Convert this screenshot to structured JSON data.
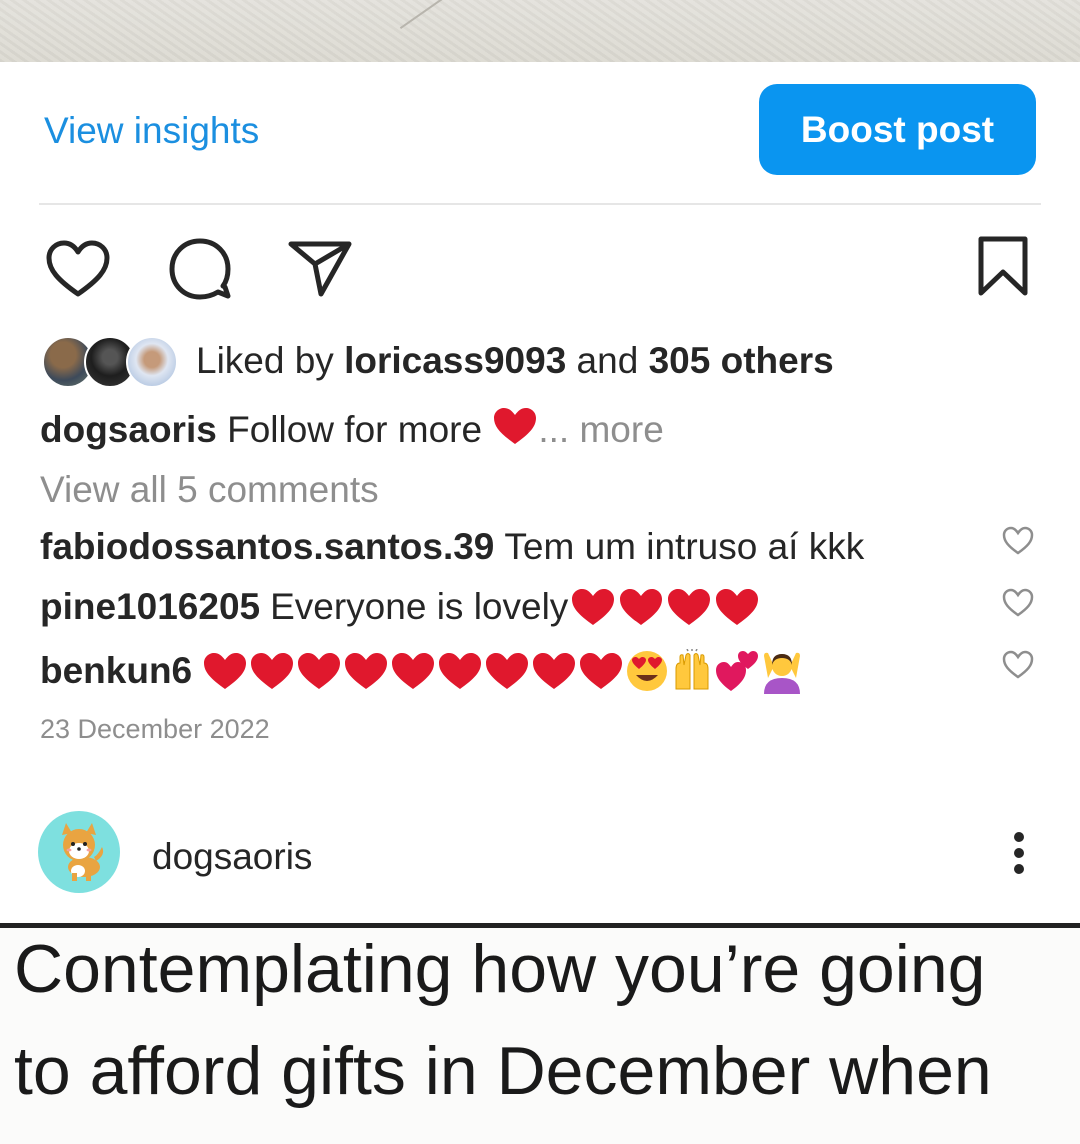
{
  "post1": {
    "actions": {
      "view_insights": "View insights",
      "boost_post": "Boost post"
    },
    "likes": {
      "prefix": "Liked by ",
      "user": "loricass9093",
      "middle": " and ",
      "others": "305 others"
    },
    "caption": {
      "username": "dogsaoris",
      "text": "Follow for more",
      "ellipsis": "...",
      "more": "more"
    },
    "view_comments": "View all 5 comments",
    "comments": [
      {
        "username": "fabiodossantos.santos.39",
        "text": "Tem um intruso  aí kkk"
      },
      {
        "username": "pine1016205",
        "text": "Everyone is lovely"
      },
      {
        "username": "benkun6",
        "text": ""
      }
    ],
    "date": "23 December 2022"
  },
  "post2": {
    "username": "dogsaoris",
    "image_text": [
      "Contemplating how you’re going",
      "to afford gifts in December when"
    ]
  },
  "colors": {
    "accent": "#0a95f0",
    "link": "#1b8fe0",
    "heart": "#e0182d",
    "muted": "#8e8e8e"
  },
  "icons": [
    "heart-icon",
    "comment-icon",
    "share-icon",
    "bookmark-icon",
    "more-icon"
  ]
}
